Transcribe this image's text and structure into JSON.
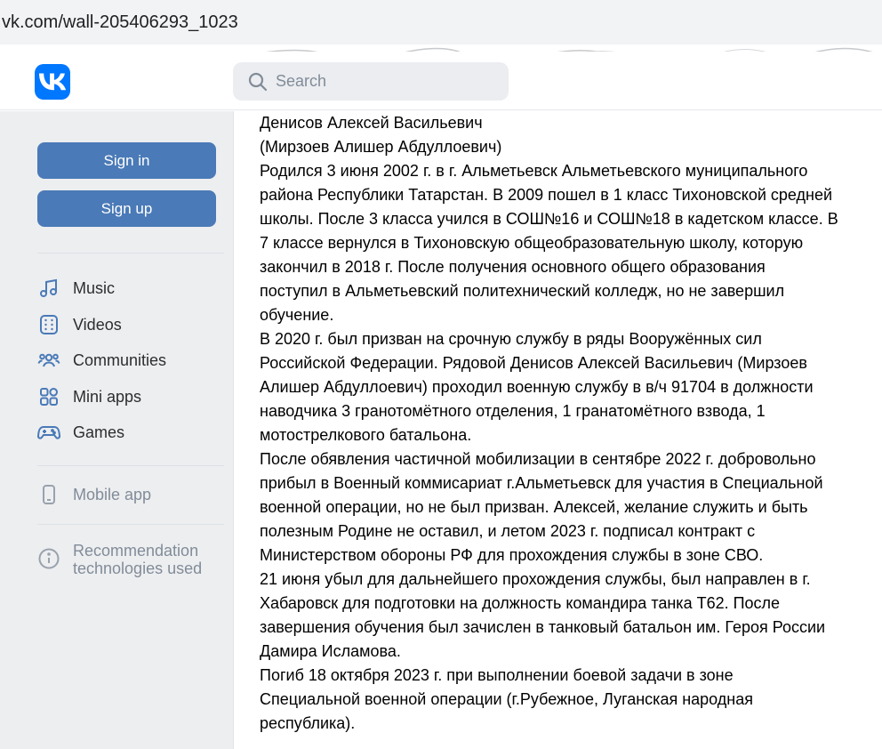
{
  "browser": {
    "url": "vk.com/wall-205406293_1023"
  },
  "header": {
    "logo_text": "VK",
    "search": {
      "placeholder": "Search"
    }
  },
  "sidebar": {
    "sign_in": "Sign in",
    "sign_up": "Sign up",
    "items": [
      {
        "label": "Music",
        "icon": "music-icon"
      },
      {
        "label": "Videos",
        "icon": "videos-icon"
      },
      {
        "label": "Communities",
        "icon": "communities-icon"
      },
      {
        "label": "Mini apps",
        "icon": "mini-apps-icon"
      },
      {
        "label": "Games",
        "icon": "games-icon"
      }
    ],
    "mobile_app": "Mobile app",
    "recommendation": {
      "line1": "Recommendation",
      "line2": "technologies used"
    }
  },
  "post": {
    "lines": [
      "Денисов Алексей Васильевич",
      "(Мирзоев Алишер Абдуллоевич)",
      "Родился 3 июня 2002 г. в г. Альметьевск Альметьевского муниципального",
      "района Республики Татарстан. В 2009 пошел в 1 класс Тихоновской средней",
      "школы. После 3 класса учился в СОШ№16 и СОШ№18 в кадетском классе. В",
      "7 классе вернулся в Тихоновскую общеобразовательную школу, которую",
      "закончил в 2018 г. После получения основного общего образования",
      "поступил в Альметьевский политехнический колледж, но не завершил",
      "обучение.",
      "В 2020 г. был призван на срочную службу в ряды Вооружённых сил",
      "Российской Федерации. Рядовой Денисов Алексей Васильевич (Мирзоев",
      "Алишер Абдуллоевич) проходил военную службу в в/ч 91704 в должности",
      "наводчика 3 гранотомётного отделения, 1 гранатомётного взвода, 1",
      "мотострелкового батальона.",
      "После обявления частичной мобилизации в сентябре 2022 г. добровольно",
      "прибыл в Военный коммисариат г.Альметьевск для участия в Специальной",
      "военной операции, но не был призван. Алексей, желание служить и быть",
      "полезным Родине не оставил, и летом 2023 г. подписал контракт с",
      "Министерством обороны РФ для прохождения службы в зоне СВО.",
      "21 июня убыл для дальнейшего прохождения службы, был направлен в г.",
      "Хабаровск для подготовки на должность командира танка Т62. После",
      "завершения обучения был зачислен в танковый батальон им. Героя России",
      "Дамира Исламова.",
      "Погиб 18 октября 2023 г. при выполнении боевой задачи в зоне",
      "Специальной военной операции (г.Рубежное, Луганская народная",
      "республика)."
    ]
  },
  "colors": {
    "brand": "#0077ff",
    "button": "#4a7ab7",
    "sidebar_bg": "#edeef0",
    "icon": "#4a7ab7"
  }
}
